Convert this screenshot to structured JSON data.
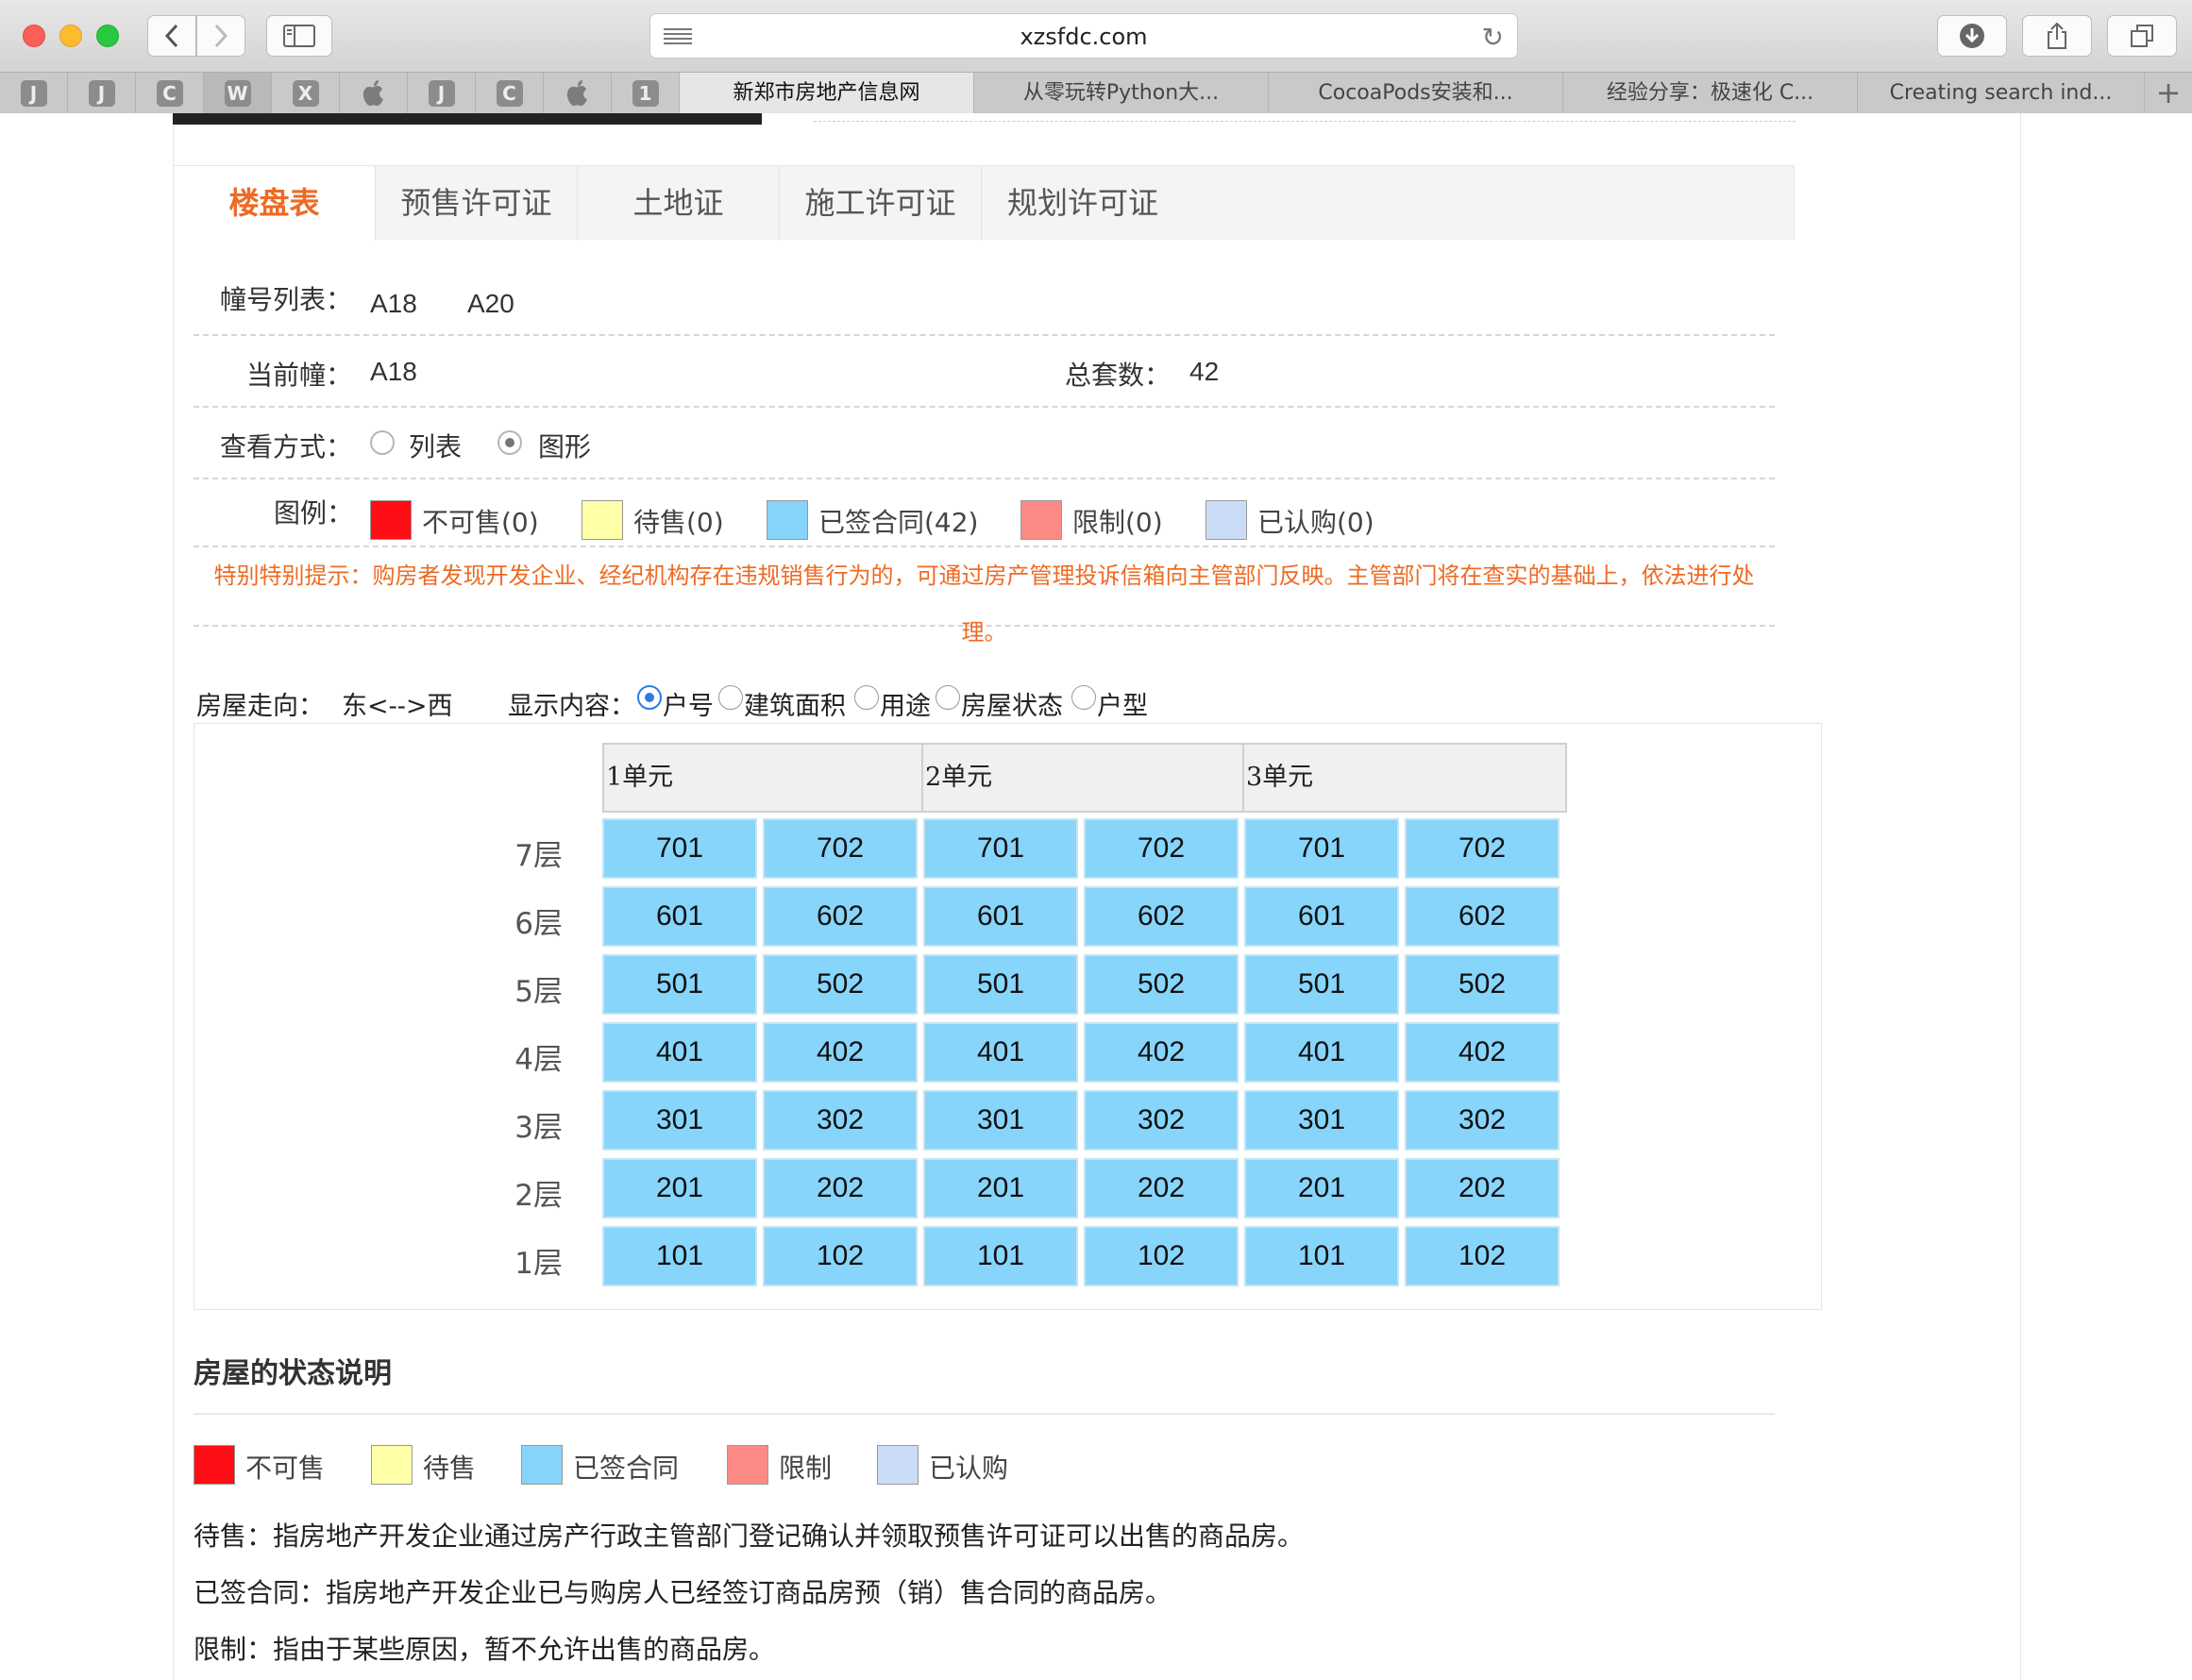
{
  "browser": {
    "url": "xzsfdc.com",
    "pinned_tabs": [
      "J",
      "J",
      "C",
      "W",
      "X",
      "",
      "J",
      "C",
      "",
      "1"
    ],
    "tabs": [
      "新郑市房地产信息网",
      "从零玩转Python大...",
      "CocoaPods安装和...",
      "经验分享：极速化 C...",
      "Creating search ind..."
    ],
    "new_tab": "+"
  },
  "page_tabs": [
    "楼盘表",
    "预售许可证",
    "土地证",
    "施工许可证",
    "规划许可证"
  ],
  "building": {
    "list_label": "幢号列表：",
    "list": [
      "A18",
      "A20"
    ],
    "current_label": "当前幢：",
    "current": "A18",
    "total_label": "总套数：",
    "total": "42"
  },
  "view": {
    "label": "查看方式：",
    "options": [
      "列表",
      "图形"
    ],
    "selected": "图形"
  },
  "legend": {
    "label": "图例：",
    "items": [
      {
        "label": "不可售(0)",
        "color": "#ff0e15"
      },
      {
        "label": "待售(0)",
        "color": "#ffffa8"
      },
      {
        "label": "已签合同(42)",
        "color": "#86d4fa"
      },
      {
        "label": "限制(0)",
        "color": "#fe8a85"
      },
      {
        "label": "已认购(0)",
        "color": "#cbdcf6"
      }
    ]
  },
  "notice": "特别特别提示：购房者发现开发企业、经纪机构存在违规销售行为的，可通过房产管理投诉信箱向主管部门反映。主管部门将在查实的基础上，依法进行处理。",
  "direction": {
    "label": "房屋走向：",
    "value": "东<-->西",
    "display_label": "显示内容：",
    "display_options": [
      "户号",
      "建筑面积",
      "用途",
      "房屋状态",
      "户型"
    ],
    "display_selected": "户号"
  },
  "units": [
    "1单元",
    "2单元",
    "3单元"
  ],
  "floors": [
    {
      "label": "7层",
      "rooms": [
        "701",
        "702",
        "701",
        "702",
        "701",
        "702"
      ]
    },
    {
      "label": "6层",
      "rooms": [
        "601",
        "602",
        "601",
        "602",
        "601",
        "602"
      ]
    },
    {
      "label": "5层",
      "rooms": [
        "501",
        "502",
        "501",
        "502",
        "501",
        "502"
      ]
    },
    {
      "label": "4层",
      "rooms": [
        "401",
        "402",
        "401",
        "402",
        "401",
        "402"
      ]
    },
    {
      "label": "3层",
      "rooms": [
        "301",
        "302",
        "301",
        "302",
        "301",
        "302"
      ]
    },
    {
      "label": "2层",
      "rooms": [
        "201",
        "202",
        "201",
        "202",
        "201",
        "202"
      ]
    },
    {
      "label": "1层",
      "rooms": [
        "101",
        "102",
        "101",
        "102",
        "101",
        "102"
      ]
    }
  ],
  "status_section": {
    "title": "房屋的状态说明",
    "items": [
      {
        "label": "不可售",
        "color": "#ff0e15"
      },
      {
        "label": "待售",
        "color": "#ffffa8"
      },
      {
        "label": "已签合同",
        "color": "#86d4fa"
      },
      {
        "label": "限制",
        "color": "#fe8a85"
      },
      {
        "label": "已认购",
        "color": "#cbdcf6"
      }
    ],
    "descriptions": [
      "待售：指房地产开发企业通过房产行政主管部门登记确认并领取预售许可证可以出售的商品房。",
      "已签合同：指房地产开发企业已与购房人已经签订商品房预（销）售合同的商品房。",
      "限制：指由于某些原因，暂不允许出售的商品房。"
    ]
  }
}
